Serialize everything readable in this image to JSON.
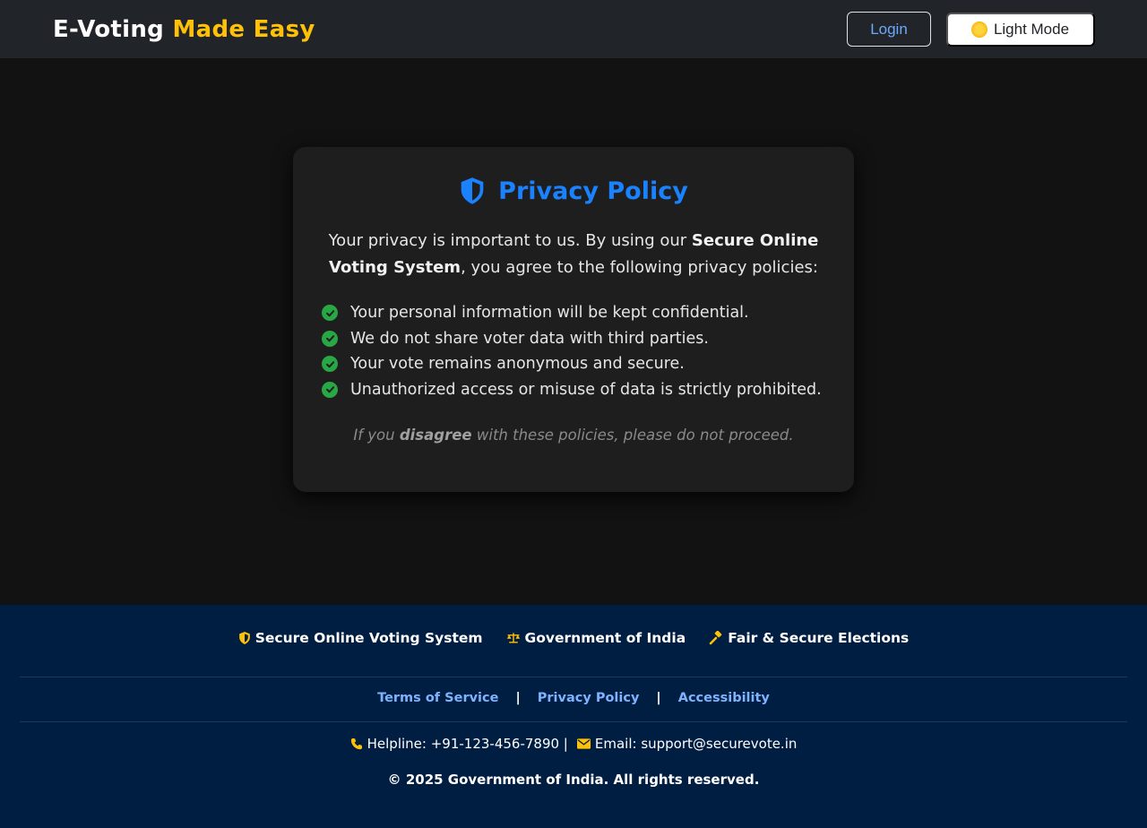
{
  "navbar": {
    "brand_primary": "E-Voting",
    "brand_accent": "Made Easy",
    "login_label": "Login",
    "theme_label": "Light Mode",
    "theme_icon": "sun-icon"
  },
  "card": {
    "title": "Privacy Policy",
    "title_icon": "shield-icon",
    "intro_prefix": "Your privacy is important to us. By using our",
    "intro_bold": "Secure Online Voting System",
    "intro_suffix": ", you agree to the following privacy policies:",
    "items": [
      {
        "text": "Your personal information will be kept confidential.",
        "icon": "check-circle-icon"
      },
      {
        "text": "We do not share voter data with third parties.",
        "icon": "check-circle-icon"
      },
      {
        "text": "Your vote remains anonymous and secure.",
        "icon": "check-circle-icon"
      },
      {
        "text": "Unauthorized access or misuse of data is strictly prohibited.",
        "icon": "check-circle-icon"
      }
    ],
    "disagree_prefix": "If you",
    "disagree_bold": "disagree",
    "disagree_suffix": "with these policies, please do not proceed."
  },
  "footer": {
    "badges": [
      {
        "label": "Secure Online Voting System",
        "icon": "shield-icon"
      },
      {
        "label": "Government of India",
        "icon": "scale-icon"
      },
      {
        "label": "Fair & Secure Elections",
        "icon": "gavel-icon"
      }
    ],
    "links": [
      "Terms of Service",
      "Privacy Policy",
      "Accessibility"
    ],
    "separator": "|",
    "helpline": "Helpline: +91-123-456-7890 |",
    "email": "Email: support@securevote.in",
    "copyright": "© 2025 Government of India. All rights reserved."
  },
  "colors": {
    "accent_yellow": "#ffc107",
    "title_blue": "#1a82ff",
    "check_green": "#28a745",
    "footer_bg": "#001e42",
    "link_blue": "#7fb2ff"
  }
}
